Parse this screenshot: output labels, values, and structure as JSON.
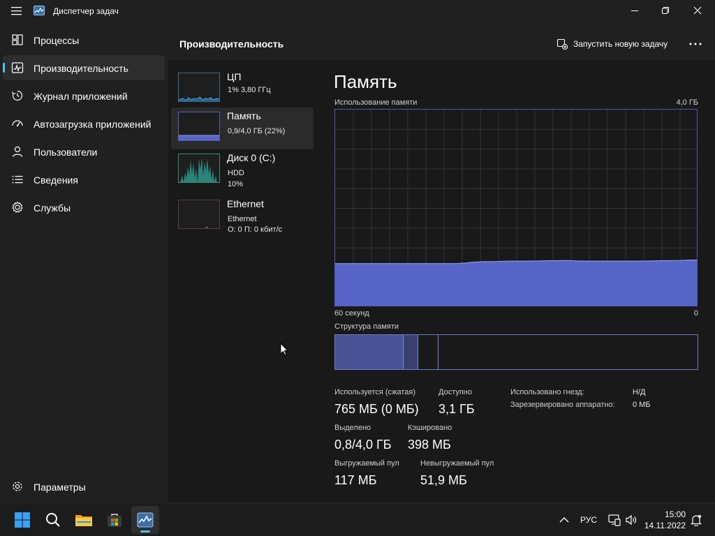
{
  "window": {
    "title": "Диспетчер задач"
  },
  "sidebar": {
    "items": [
      {
        "label": "Процессы",
        "icon": "processes-icon"
      },
      {
        "label": "Производительность",
        "icon": "performance-icon",
        "active": true
      },
      {
        "label": "Журнал приложений",
        "icon": "app-history-icon"
      },
      {
        "label": "Автозагрузка приложений",
        "icon": "startup-icon"
      },
      {
        "label": "Пользователи",
        "icon": "users-icon"
      },
      {
        "label": "Сведения",
        "icon": "details-icon"
      },
      {
        "label": "Службы",
        "icon": "services-icon"
      }
    ],
    "settings_label": "Параметры"
  },
  "header": {
    "title": "Производительность",
    "run_task_label": "Запустить новую задачу"
  },
  "tiles": [
    {
      "name": "ЦП",
      "sub1": "1% 3,80 ГГц",
      "sub2": ""
    },
    {
      "name": "Память",
      "sub1": "0,9/4,0 ГБ (22%)",
      "sub2": ""
    },
    {
      "name": "Диск 0 (C:)",
      "sub1": "HDD",
      "sub2": "10%"
    },
    {
      "name": "Ethernet",
      "sub1": "Ethernet",
      "sub2": "О: 0 П: 0 кбит/с"
    }
  ],
  "memory": {
    "title": "Память",
    "usage_label": "Использование памяти",
    "max_label": "4,0 ГБ",
    "time_left_label": "60 секунд",
    "time_right_label": "0",
    "structure_label": "Структура памяти",
    "usage_history_percent": [
      22,
      22,
      22,
      22,
      22,
      22,
      22,
      22,
      22,
      22,
      22,
      22,
      22,
      22,
      22.3,
      22.8,
      23,
      23,
      23.2,
      23.3,
      23.3,
      23.3,
      23.4,
      23.5,
      23.5,
      23.6,
      23.4,
      23.3,
      23.3,
      23.3,
      23.3,
      23.3,
      23.3,
      23.3,
      23.4,
      23.5,
      23.5,
      23.6,
      23.8,
      23.8
    ],
    "colors": {
      "fill": "#5865c8",
      "line": "#8c97e6",
      "grid": "#343434",
      "border": "#4f5eb8"
    },
    "stats": {
      "in_use_label": "Используется (сжатая)",
      "in_use_value": "765 МБ (0 МБ)",
      "available_label": "Доступно",
      "available_value": "3,1 ГБ",
      "committed_label": "Выделено",
      "committed_value": "0,8/4,0 ГБ",
      "cached_label": "Кэшировано",
      "cached_value": "398 МБ",
      "paged_label": "Выгружаемый пул",
      "paged_value": "117 МБ",
      "nonpaged_label": "Невыгружаемый пул",
      "nonpaged_value": "51,9 МБ",
      "slots_label": "Использовано гнезд:",
      "slots_value": "Н/Д",
      "reserved_label": "Зарезервировано аппаратно:",
      "reserved_value": "0 МБ"
    }
  },
  "taskbar": {
    "icons": [
      "windows-start-icon",
      "search-icon",
      "file-explorer-icon",
      "microsoft-store-icon",
      "task-manager-icon"
    ],
    "language": "РУС",
    "time": "15:00",
    "date": "14.11.2022"
  }
}
